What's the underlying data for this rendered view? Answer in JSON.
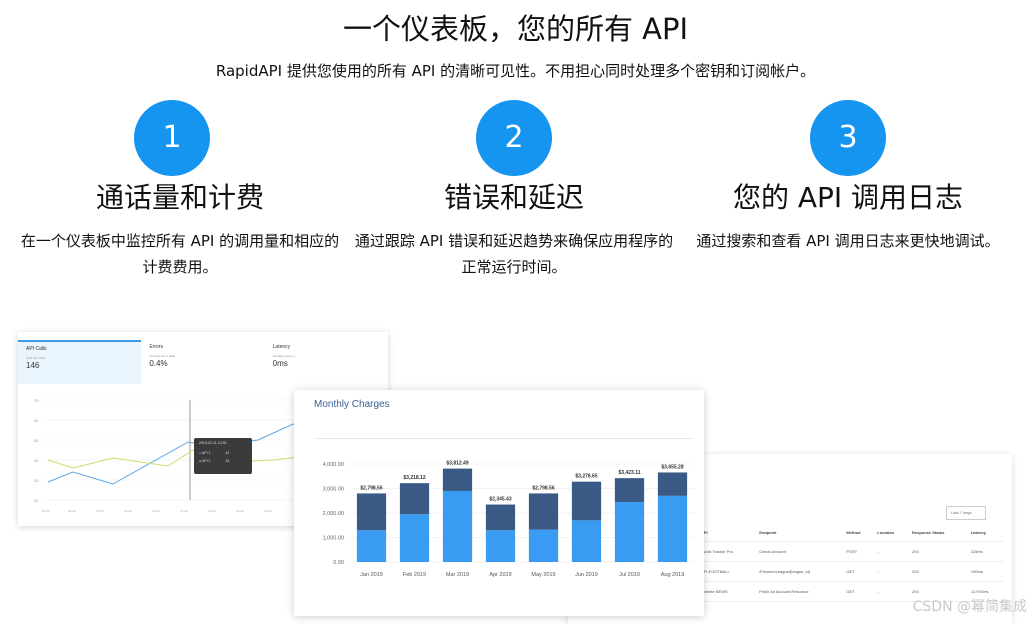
{
  "hero": {
    "title": "一个仪表板，您的所有 API",
    "subtitle": "RapidAPI 提供您使用的所有 API 的清晰可见性。不用担心同时处理多个密钥和订阅帐户。"
  },
  "features": [
    {
      "number": "1",
      "title": "通话量和计费",
      "description": "在一个仪表板中监控所有 API 的调用量和相应的计费费用。"
    },
    {
      "number": "2",
      "title": "错误和延迟",
      "description": "通过跟踪 API 错误和延迟趋势来确保应用程序的正常运行时间。"
    },
    {
      "number": "3",
      "title": "您的 API 调用日志",
      "description": "通过搜索和查看 API 调用日志来更快地调试。"
    }
  ],
  "dashboard": {
    "stats": [
      {
        "label": "API Calls",
        "sub": "Total API Calls",
        "value": "146"
      },
      {
        "label": "Errors",
        "sub": "Average Error Rate",
        "value": "0.4%"
      },
      {
        "label": "Latency",
        "sub": "Average Latency",
        "value": "0ms"
      }
    ],
    "y_ticks": [
      "70",
      "60",
      "50",
      "40",
      "30",
      "20",
      "10"
    ],
    "tooltip": {
      "date": "2019-02-11 12:30",
      "row1_label": "API 1",
      "row1_value": "42",
      "row2_label": "API 2",
      "row2_value": "33"
    }
  },
  "charges": {
    "title": "Monthly Charges"
  },
  "chart_data": {
    "type": "bar",
    "title": "Monthly Charges",
    "categories": [
      "Jan 2019",
      "Feb 2019",
      "Mar 2019",
      "Apr 2019",
      "May 2019",
      "Jun 2019",
      "Jul 2019",
      "Aug 2019"
    ],
    "totals": [
      2798.56,
      3218.12,
      3812.49,
      2345.43,
      2798.56,
      3278.65,
      3423.11,
      3655.28
    ],
    "total_labels": [
      "$2,798.56",
      "$3,218.12",
      "$3,812.49",
      "$2,345.43",
      "$2,798.56",
      "$3,278.65",
      "$3,423.11",
      "$3,655.28"
    ],
    "series": [
      {
        "values": [
          1300,
          1950,
          2900,
          1300,
          1320,
          1700,
          2450,
          2700
        ],
        "color": "#3a9bf2"
      },
      {
        "values": [
          1498.56,
          1268.12,
          912.49,
          1045.43,
          1478.56,
          1578.65,
          973.11,
          955.28
        ],
        "color": "#3a5a86"
      }
    ],
    "y_ticks": [
      "4,000.00",
      "3,000.00",
      "2,000.00",
      "1,000.00",
      "0.00"
    ],
    "ylim": [
      0,
      4000
    ]
  },
  "logs": {
    "range_label": "Last 7 days",
    "headers": [
      "API",
      "Endpoint",
      "Method",
      "Location",
      "Response Status",
      "Latency"
    ],
    "rows": [
      [
        "Covid Tracker Pro",
        "Check Account",
        "POST",
        "-",
        "200",
        "115ms"
      ],
      [
        "API-FOOTBALL",
        "/Fixtures/League/{league_id}",
        "GET",
        "-",
        "200",
        "190ms"
      ],
      [
        "Fortnite NEWS",
        "Fetch An Account Resource",
        "GET",
        "-",
        "200",
        "12,970ms"
      ]
    ]
  },
  "watermark": "CSDN @幂简集成"
}
